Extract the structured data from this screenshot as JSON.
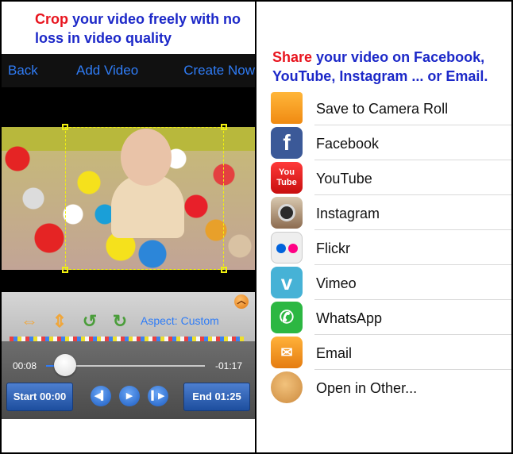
{
  "left_panel": {
    "promo_highlight": "Crop",
    "promo_rest": "your video freely with no loss in video quality",
    "nav": {
      "back": "Back",
      "add_video": "Add Video",
      "create_now": "Create Now"
    },
    "toolbar": {
      "collapse_icon": "chevron-up",
      "aspect_label": "Aspect: Custom"
    },
    "timeline": {
      "current_time": "00:08",
      "remaining_time": "-01:17",
      "progress": 0.12,
      "start_label": "Start 00:00",
      "end_label": "End 01:25"
    }
  },
  "right_panel": {
    "share_highlight": "Share",
    "share_rest": "your video on Facebook, YouTube, Instagram ... or Email.",
    "items": [
      {
        "label": "Save to Camera Roll",
        "icon": "folder-icon"
      },
      {
        "label": "Facebook",
        "icon": "facebook-icon"
      },
      {
        "label": "YouTube",
        "icon": "youtube-icon"
      },
      {
        "label": "Instagram",
        "icon": "instagram-icon"
      },
      {
        "label": "Flickr",
        "icon": "flickr-icon"
      },
      {
        "label": "Vimeo",
        "icon": "vimeo-icon"
      },
      {
        "label": "WhatsApp",
        "icon": "whatsapp-icon"
      },
      {
        "label": "Email",
        "icon": "email-icon"
      },
      {
        "label": "Open in Other...",
        "icon": "open-in-other-icon"
      }
    ]
  },
  "colors": {
    "accent_blue": "#2f7cf6",
    "headline_blue": "#1c28c8",
    "headline_red": "#e8141e",
    "crop_handle": "#f0f010"
  }
}
